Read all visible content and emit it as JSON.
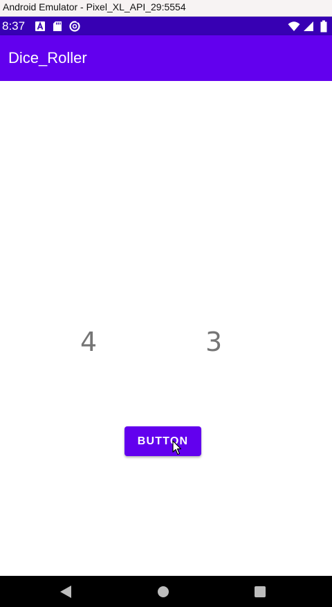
{
  "emulator": {
    "window_title": "Android Emulator - Pixel_XL_API_29:5554"
  },
  "status_bar": {
    "time": "8:37",
    "background_color": "#3700b3",
    "left_icons": [
      "a-notification-icon",
      "sd-card-icon",
      "data-saver-icon"
    ],
    "right_icons": [
      "wifi-icon",
      "cellular-signal-icon",
      "battery-icon"
    ]
  },
  "app_bar": {
    "title": "Dice_Roller",
    "background_color": "#6200ee"
  },
  "main": {
    "die_one_value": "4",
    "die_two_value": "3",
    "roll_button_label": "BUTTON",
    "accent_color": "#6200ee"
  },
  "nav_bar": {
    "buttons": [
      "back-icon",
      "home-icon",
      "recents-icon"
    ]
  }
}
